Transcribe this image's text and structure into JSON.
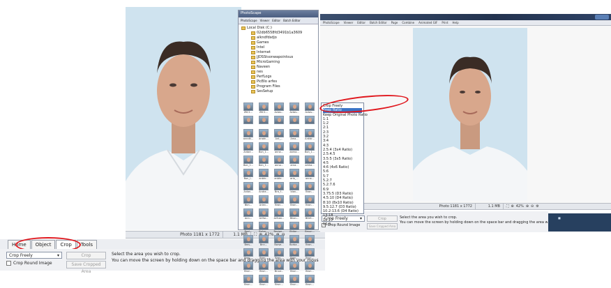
{
  "left": {
    "status": {
      "photo_info": "Photo 1181 x 1772",
      "size": "1.1 MB",
      "zoom": "42%"
    },
    "tabs": [
      "Home",
      "Object",
      "Crop",
      "Tools"
    ],
    "active_tab": "Crop",
    "crop_dropdown": "Crop Freely",
    "crop_button": "Crop",
    "save_cropped_button": "Save Cropped Area",
    "crop_round_label": "Crop Round Image",
    "hint_line1": "Select the area you wish to crop.",
    "hint_line2": "You can move the screen by holding down on the space bar and dragging the area with your mous"
  },
  "browser": {
    "title": "PhotoScape",
    "toolbar": [
      "PhotoScape",
      "Viewer",
      "Editor",
      "Batch Editor",
      "Page",
      "Combine",
      "Animated GIF",
      "Print",
      "Help"
    ],
    "tree": [
      "Local Disk (C:)",
      "02db6558fd3491b1a3609",
      "alkndfdsdjo",
      "Games",
      "Intel",
      "Internet",
      "JJDSStsonwapointsus",
      "MicroGaming",
      "Naveen",
      "nes",
      "PerfLogs",
      "PicBlo arfes",
      "Program Files",
      "SesSetup"
    ],
    "thumb_captions": [
      "ZKC1...",
      "ZKC1...",
      "Actav...",
      "Actav...",
      "Actav...",
      "",
      "",
      "",
      "",
      "",
      "anndit...",
      "aradn...",
      "Ant_...",
      "Ama...",
      "Antidr...",
      "Antae...",
      "Bon_1...",
      "anna...",
      "aarna...",
      "Bon_1...",
      "Bon_1...",
      "Ben_1...",
      "anno...",
      "arna...",
      "arkha...",
      "Bon_l...",
      "anbhr...",
      "anbhr...",
      "aria_...",
      "anna...",
      "Anlan...",
      "Andra...",
      "Bra_f...",
      "bian...",
      "Bran...",
      "Bbn...",
      "Arlan...",
      "Bran...",
      "Bran...",
      "Bran...",
      "Ann...",
      "Arlfar...",
      "Arlhan...",
      "Bilan...",
      "BDrit...",
      "Bonl...",
      "Beher...",
      "Besipe...",
      "Bhiter...",
      "Bmun...",
      "Bms...",
      "Bnn...",
      "Borse...",
      "Borba...",
      "Bran...",
      "Bran...",
      "Bran...",
      "Bran...",
      "Bran...",
      "Brun...",
      "Brun...",
      "Brun...",
      "Bruur...",
      "Brun...",
      "Brun...",
      "Brun...",
      "Brun...",
      "Brun...",
      "Brun...",
      "Brun..."
    ]
  },
  "right": {
    "window_menu": [
      "PhotoScape",
      "Viewer",
      "Editor",
      "Batch Editor",
      "Page",
      "Combine",
      "Animated GIF",
      "Print",
      "Help"
    ],
    "status": {
      "photo_info": "Photo 1181 x 1772",
      "size": "1.1 MB",
      "zoom": "42%"
    },
    "dropdown_value": "Crop Freely",
    "crop_button": "Crop",
    "save_cropped_button": "Save Cropped Area",
    "crop_round_label": "Crop Round Image",
    "hint_line1": "Select the area you wish to crop.",
    "hint_line2": "You can move the screen by holding down on the space bar and dragging the area with your mouse",
    "dropdown_options": [
      "Crop Freely",
      "Keep Ratio",
      "Keep Original Photo Ratio",
      "1:1",
      "1:2",
      "2:1",
      "2:3",
      "3:2",
      "3:4",
      "4:3",
      "2.5:4 (3x4 Ratio)",
      "2.5:4.5",
      "3.5:5 (3x5 Ratio)",
      "4:5",
      "4:6 (4x6 Ratio)",
      "5:6",
      "5:7",
      "5.2:7",
      "5.2:7.6",
      "6:9",
      "3.75:5 (D3 Ratio)",
      "4.5:10 (D4 Ratio)",
      "8:10 (8x10 Ratio)",
      "9.5:12.7 (D3 Ratio)",
      "10.2:13.6 (D4 Ratio)",
      "13:18",
      "12:17",
      "16:9"
    ],
    "selected_option": "Keep Ratio"
  },
  "colors": {
    "annotation_red": "#e0161c",
    "selection_blue": "#3b74c5",
    "photo_bg": "#cfe3ef"
  }
}
